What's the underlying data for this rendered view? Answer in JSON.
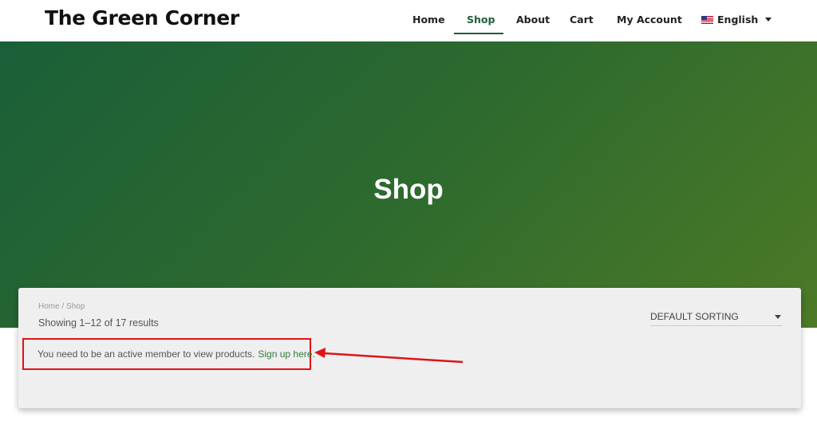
{
  "header": {
    "logo": "The Green Corner",
    "nav": [
      {
        "label": "Home"
      },
      {
        "label": "Shop"
      },
      {
        "label": "About"
      },
      {
        "label": "Cart"
      },
      {
        "label": "My Account"
      }
    ],
    "language": "English",
    "flag_icon": "us-flag-icon"
  },
  "hero": {
    "title": "Shop"
  },
  "shop": {
    "breadcrumb_home": "Home",
    "breadcrumb_sep": " / ",
    "breadcrumb_current": "Shop",
    "results": "Showing 1–12 of 17 results",
    "sort_selected": "DEFAULT SORTING",
    "notice_text": "You need to be an active member to view products.",
    "notice_link": "Sign up here."
  },
  "colors": {
    "brand_green": "#1e5e3a",
    "highlight_red": "#e01414",
    "link_green": "#2e7d3a"
  }
}
